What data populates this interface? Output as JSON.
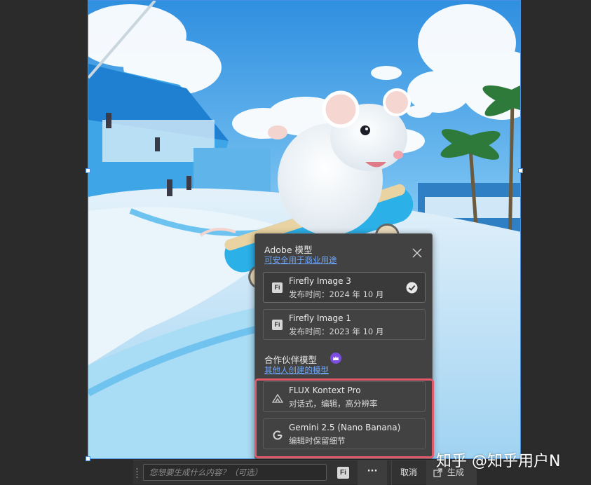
{
  "colors": {
    "app_background": "#2b2b2b",
    "panel_background": "#424242",
    "link": "#6ea8ff",
    "highlight_border": "#e05a6a",
    "premium_badge": "#7b4de0",
    "selection_border": "#4a90e2"
  },
  "canvas": {
    "image_subject": "white mouse riding a blue skateboard in a skate park"
  },
  "model_panel": {
    "adobe_section": {
      "title": "Adobe 模型",
      "link": "可安全用于商业用途"
    },
    "adobe_models": [
      {
        "name": "Firefly Image 3",
        "release": "发布时间：2024 年 10 月",
        "icon": "fi-icon",
        "selected": true
      },
      {
        "name": "Firefly Image 1",
        "release": "发布时间：2023 年 10 月",
        "icon": "fi-icon",
        "selected": false
      }
    ],
    "partner_section": {
      "title": "合作伙伴模型",
      "link": "其他人创建的模型",
      "badge_icon": "crown-icon"
    },
    "partner_models": [
      {
        "name": "FLUX Kontext Pro",
        "desc": "对话式，编辑，高分辨率",
        "icon": "flux-icon"
      },
      {
        "name": "Gemini 2.5 (Nano Banana)",
        "desc": "编辑时保留细节",
        "icon": "google-g-icon"
      }
    ],
    "close_icon": "close-icon"
  },
  "prompt_bar": {
    "placeholder": "您想要生成什么内容？（可选）",
    "fi_label": "Fi",
    "more_label": "···",
    "cancel_label": "取消",
    "generate_label": "生成"
  },
  "watermark": "知乎 @知乎用户N"
}
